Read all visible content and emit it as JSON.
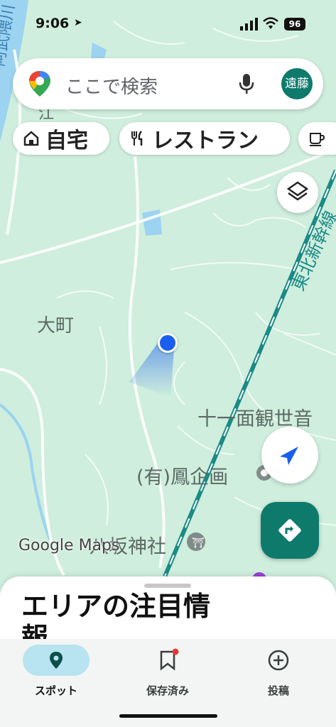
{
  "status_bar": {
    "time": "9:06",
    "battery": "96"
  },
  "search": {
    "placeholder": "ここで検索",
    "avatar_text": "遠藤"
  },
  "chips": [
    {
      "label": "自宅",
      "icon": "home-icon"
    },
    {
      "label": "レストラン",
      "icon": "restaurant-icon"
    },
    {
      "label": "",
      "icon": "cafe-icon"
    }
  ],
  "map_labels": {
    "river": "阿武隈川",
    "edge_label": "江",
    "town": "大町",
    "shinkansen": "東北新幹線",
    "kannon": "十一面観世音",
    "company": "(有)鳳企画",
    "shrine": "八坂神社",
    "watermark": "Google Maps"
  },
  "sheet": {
    "title": "エリアの注目情報"
  },
  "nav": [
    {
      "label": "スポット",
      "icon": "pin-icon",
      "active": true
    },
    {
      "label": "保存済み",
      "icon": "bookmark-icon",
      "active": false
    },
    {
      "label": "投稿",
      "icon": "add-circle-icon",
      "active": false
    }
  ],
  "colors": {
    "map_bg": "#cfeedd",
    "accent": "#0d7a6c",
    "location_dot": "#1a5ef0",
    "active_nav": "#b8e3f0"
  }
}
